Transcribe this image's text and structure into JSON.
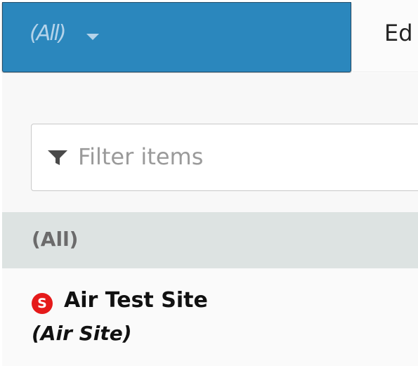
{
  "selector": {
    "value": "(All)",
    "caret_icon": "caret-down-icon"
  },
  "edit_tab": {
    "label": "Ed"
  },
  "filter": {
    "placeholder": "Filter items",
    "icon": "filter-icon",
    "value": ""
  },
  "list": {
    "all_item": {
      "label": "(All)",
      "selected": true
    },
    "items": [
      {
        "badge": "S",
        "badge_color": "#e51a1a",
        "name": "Air Test Site",
        "type": "(Air Site)"
      }
    ]
  },
  "colors": {
    "selector_bg": "#2b87bd",
    "selected_row_bg": "#dde3e2",
    "badge_red": "#e51a1a"
  }
}
